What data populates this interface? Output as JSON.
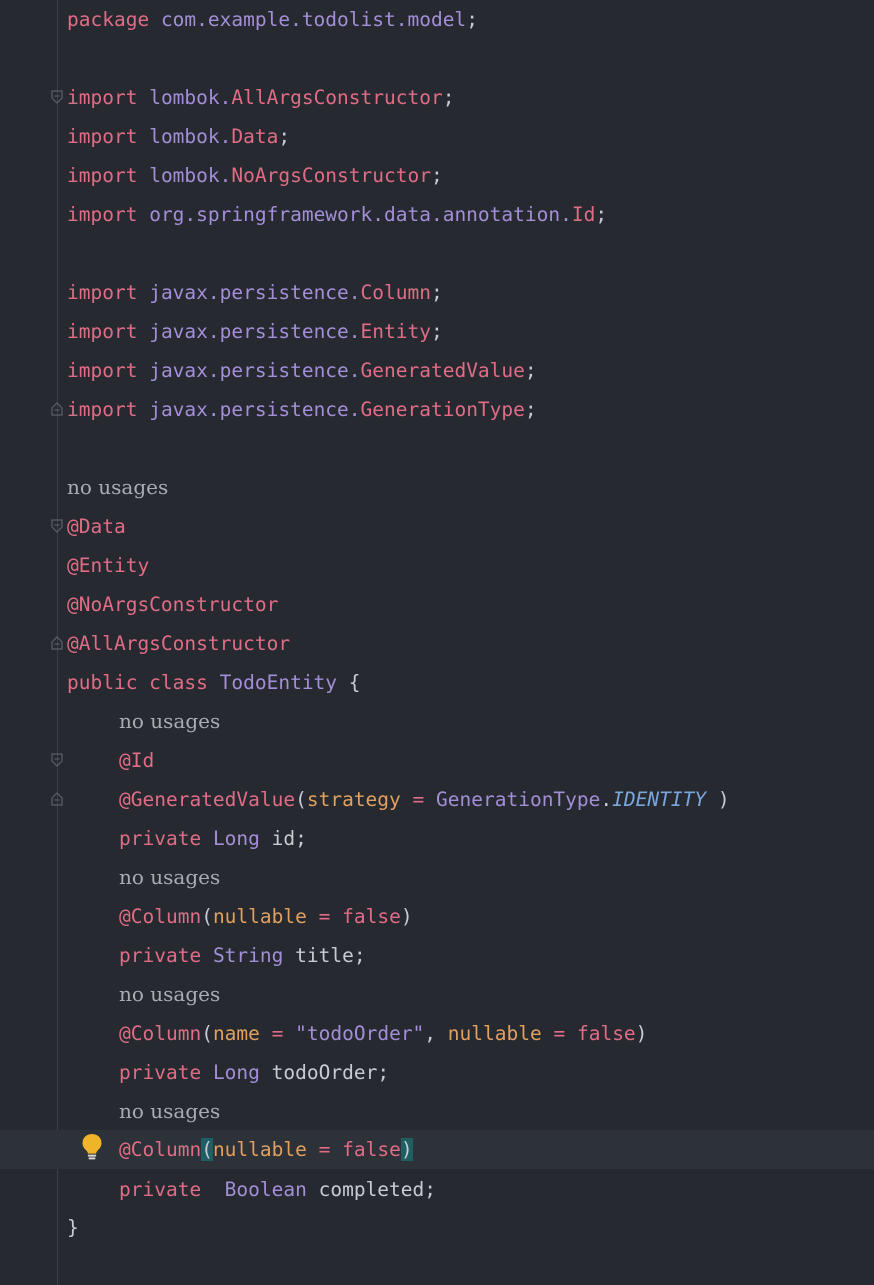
{
  "editor": {
    "hint_label": "no usages",
    "lines": {
      "l1": {
        "kw": "package",
        "pkg": "com.example.todolist.model",
        "punc": ";"
      },
      "l3": {
        "kw": "import",
        "pkg": "lombok.",
        "cls": "AllArgsConstructor",
        "punc": ";"
      },
      "l4": {
        "kw": "import",
        "pkg": "lombok.",
        "cls": "Data",
        "punc": ";"
      },
      "l5": {
        "kw": "import",
        "pkg": "lombok.",
        "cls": "NoArgsConstructor",
        "punc": ";"
      },
      "l6": {
        "kw": "import",
        "pkg": "org.springframework.data.annotation.",
        "cls": "Id",
        "punc": ";"
      },
      "l8": {
        "kw": "import",
        "pkg": "javax.persistence.",
        "cls": "Column",
        "punc": ";"
      },
      "l9": {
        "kw": "import",
        "pkg": "javax.persistence.",
        "cls": "Entity",
        "punc": ";"
      },
      "l10": {
        "kw": "import",
        "pkg": "javax.persistence.",
        "cls": "GeneratedValue",
        "punc": ";"
      },
      "l11": {
        "kw": "import",
        "pkg": "javax.persistence.",
        "cls": "GenerationType",
        "punc": ";"
      },
      "l13": {
        "ann": "@Data"
      },
      "l14": {
        "ann": "@Entity"
      },
      "l15": {
        "ann": "@NoArgsConstructor"
      },
      "l16": {
        "ann": "@AllArgsConstructor"
      },
      "l17": {
        "kw": "public class",
        "typ": "TodoEntity",
        "punc": "{"
      },
      "l19": {
        "ann": "@Id"
      },
      "l20": {
        "ann": "@GeneratedValue",
        "open": "(",
        "param": "strategy",
        "eq": "=",
        "typ": "GenerationType",
        "dot": ".",
        "const": "IDENTITY",
        "close": ")"
      },
      "l21": {
        "kw": "private",
        "typ": "Long",
        "name": "id;"
      },
      "l23": {
        "ann": "@Column",
        "open": "(",
        "param": "nullable",
        "eq": "=",
        "val": "false",
        "close": ")"
      },
      "l24": {
        "kw": "private",
        "typ": "String",
        "name": "title;"
      },
      "l26": {
        "ann": "@Column",
        "open": "(",
        "param": "name",
        "eq": "=",
        "str": "\"todoOrder\"",
        "comma": ",",
        "param2": "nullable",
        "eq2": "=",
        "val": "false",
        "close": ")"
      },
      "l27": {
        "kw": "private",
        "typ": "Long",
        "name": "todoOrder;"
      },
      "l29": {
        "ann": "@Column",
        "open": "(",
        "param": "nullable",
        "eq": "=",
        "val": "false",
        "close": ")"
      },
      "l30": {
        "kw": "private",
        "typ": "Boolean",
        "name": "completed;"
      },
      "l31": {
        "punc": "}"
      }
    }
  },
  "colors": {
    "background": "#262a30",
    "keyword": "#e06c86",
    "type": "#a48ed8",
    "param": "#e0a060",
    "constant": "#7aa6dc",
    "bulb": "#f0b429"
  }
}
